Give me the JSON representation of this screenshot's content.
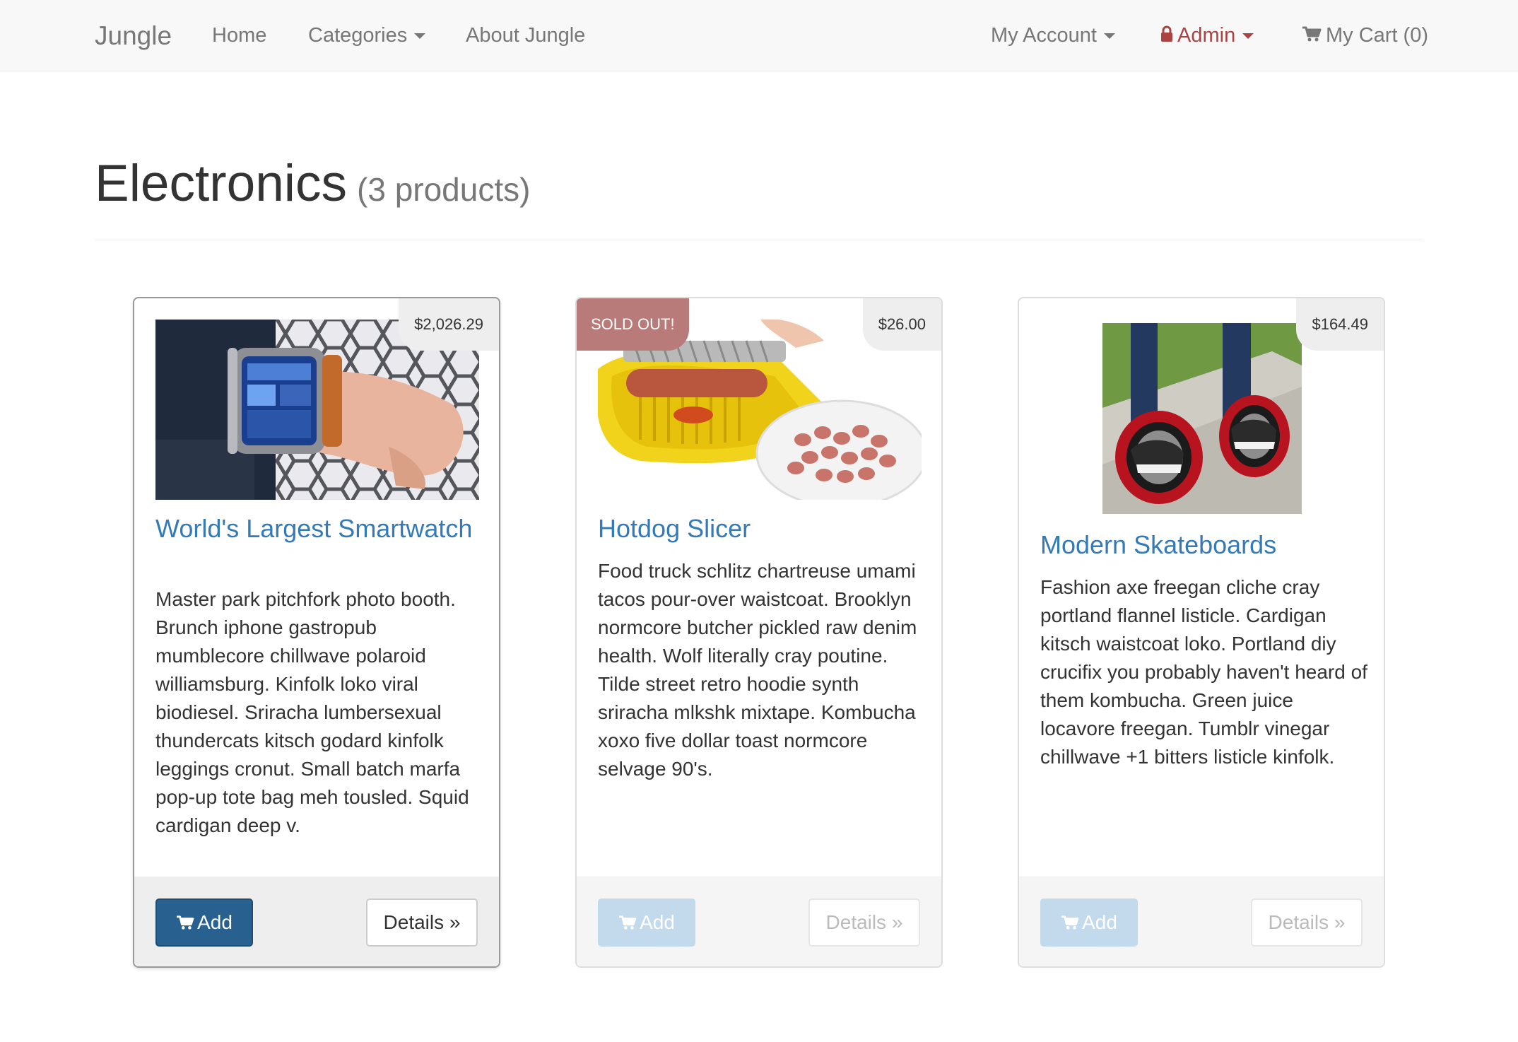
{
  "navbar": {
    "brand": "Jungle",
    "home": "Home",
    "categories": "Categories",
    "about": "About Jungle",
    "account": "My Account",
    "admin": "Admin",
    "cart": "My Cart (0)"
  },
  "header": {
    "title": "Electronics",
    "subtitle": "(3 products)"
  },
  "products": [
    {
      "name": "World's Largest Smartwatch",
      "price": "$2,026.29",
      "sold_out": "",
      "description": "Master park pitchfork photo booth. Brunch iphone gastropub mumblecore chillwave polaroid williamsburg. Kinfolk loko viral biodiesel. Sriracha lumbersexual thundercats kitsch godard kinfolk leggings cronut. Small batch marfa pop-up tote bag meh tousled. Squid cardigan deep v.",
      "add_label": "Add",
      "details_label": "Details »",
      "enabled": true
    },
    {
      "name": "Hotdog Slicer",
      "price": "$26.00",
      "sold_out": "SOLD OUT!",
      "description": "Food truck schlitz chartreuse umami tacos pour-over waistcoat. Brooklyn normcore butcher pickled raw denim health. Wolf literally cray poutine. Tilde street retro hoodie synth sriracha mlkshk mixtape. Kombucha xoxo five dollar toast normcore selvage 90's.",
      "add_label": "Add",
      "details_label": "Details »",
      "enabled": false
    },
    {
      "name": "Modern Skateboards",
      "price": "$164.49",
      "sold_out": "",
      "description": "Fashion axe freegan cliche cray portland flannel listicle. Cardigan kitsch waistcoat loko. Portland diy crucifix you probably haven't heard of them kombucha. Green juice locavore freegan. Tumblr vinegar chillwave +1 bitters listicle kinfolk.",
      "add_label": "Add",
      "details_label": "Details »",
      "enabled": false
    }
  ],
  "colors": {
    "link": "#337ab7",
    "admin": "#a94442",
    "primary_button": "#286090",
    "sold_out_badge": "#b97a7a"
  },
  "icons": [
    "lock-icon",
    "shopping-cart-icon",
    "caret-down-icon"
  ]
}
